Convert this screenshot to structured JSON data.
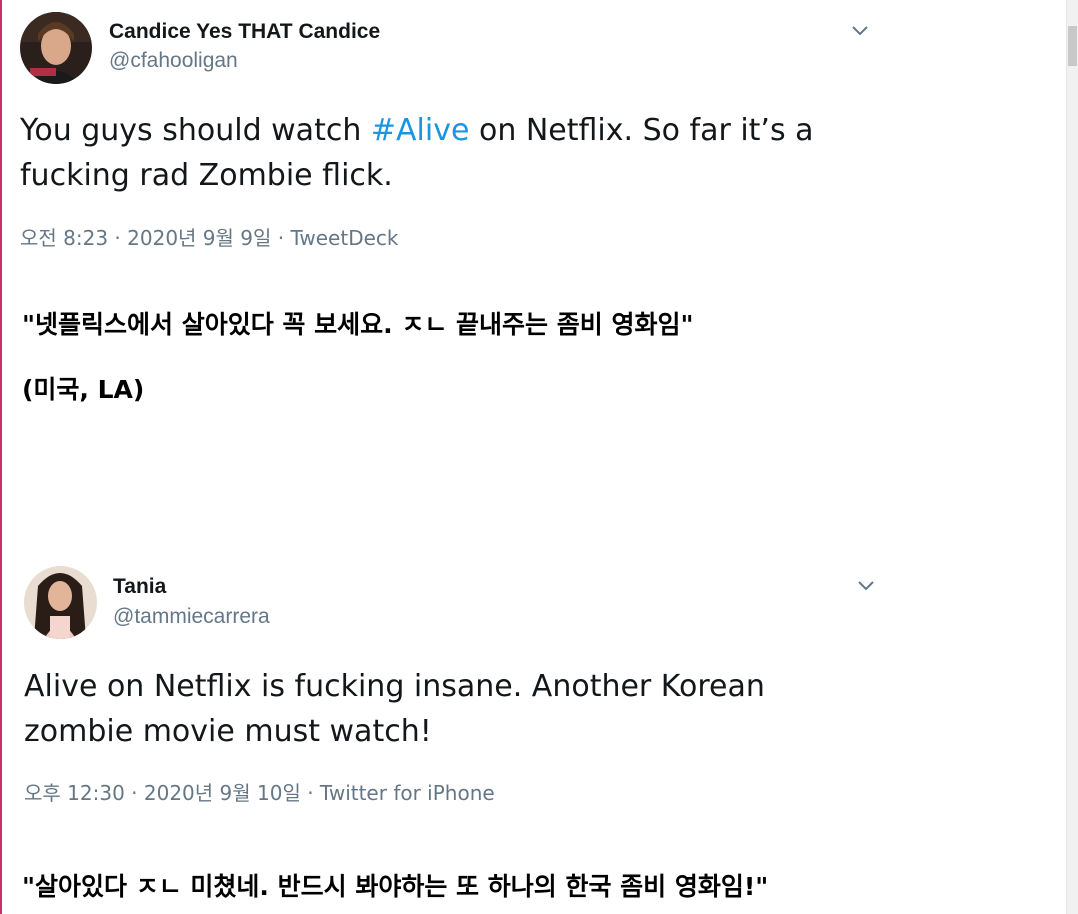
{
  "tweets": [
    {
      "display_name": "Candice Yes THAT Candice",
      "handle": "@cfahooligan",
      "text_before": "You guys should watch ",
      "hashtag": "#Alive",
      "text_after": " on Netflix. So far it’s a fucking rad Zombie flick.",
      "meta": "오전 8:23 · 2020년 9월 9일 · TweetDeck",
      "translation_line1": "\"넷플릭스에서 살아있다 꼭 보세요.  ㅈㄴ 끝내주는 좀비 영화임\"",
      "translation_line2": "(미국, LA)",
      "menu_icon": "chevron-down-icon",
      "avatar_icon": "avatar-photo"
    },
    {
      "display_name": "Tania",
      "handle": "@tammiecarrera",
      "text": "Alive on Netflix is fucking insane. Another Korean zombie movie must watch!",
      "meta": "오후 12:30 · 2020년 9월 10일 · Twitter for iPhone",
      "translation_line1": "\"살아있다 ㅈㄴ 미쳤네. 반드시 봐야하는 또 하나의 한국 좀비 영화임!\"",
      "menu_icon": "chevron-down-icon",
      "avatar_icon": "avatar-photo"
    }
  ],
  "colors": {
    "text": "#14171a",
    "secondary": "#657786",
    "hashtag": "#1b95e0",
    "left_border": "#c7306a"
  }
}
